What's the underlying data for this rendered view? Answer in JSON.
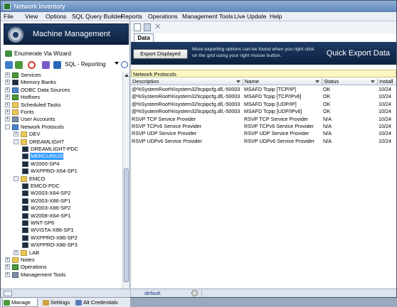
{
  "window": {
    "title": "Network Inventory"
  },
  "menu": [
    "File",
    "View",
    "Options",
    "SQL Query Builder",
    "Reports",
    "Operations",
    "Management Tools",
    "Live Update",
    "Help"
  ],
  "left_panel": {
    "banner_title": "Machine Management",
    "enumerate_label": "Enumerate Via Wizard",
    "sql_dropdown": "SQL - Reporting",
    "tree": [
      {
        "label": "Services",
        "ex": "+",
        "icon": "green",
        "depth": 0
      },
      {
        "label": "Memory Banks",
        "ex": "+",
        "icon": "pc",
        "depth": 0
      },
      {
        "label": "ODBC Data Sources",
        "ex": "+",
        "icon": "net",
        "depth": 0
      },
      {
        "label": "Hotfixes",
        "ex": "+",
        "icon": "green",
        "depth": 0
      },
      {
        "label": "Scheduled Tasks",
        "ex": "+",
        "icon": "fold",
        "depth": 0
      },
      {
        "label": "Fonts",
        "ex": "+",
        "icon": "fold",
        "depth": 0
      },
      {
        "label": "User Accounts",
        "ex": "+",
        "icon": "grp",
        "depth": 0
      },
      {
        "label": "Network Protocols",
        "ex": "-",
        "icon": "net",
        "depth": 0
      },
      {
        "label": "DEV",
        "ex": "+",
        "icon": "fold",
        "depth": 1
      },
      {
        "label": "DREAMLIGHT",
        "ex": "-",
        "icon": "fold",
        "depth": 1
      },
      {
        "label": "DREAMLIGHT-PDC",
        "ex": "",
        "icon": "pc",
        "depth": 2
      },
      {
        "label": "MERCURIUS",
        "ex": "",
        "icon": "pc",
        "depth": 2,
        "selected": true
      },
      {
        "label": "W2000-SP4",
        "ex": "",
        "icon": "pc",
        "depth": 2
      },
      {
        "label": "WXPPRO-X64-SP1",
        "ex": "",
        "icon": "pc",
        "depth": 2
      },
      {
        "label": "EMCO",
        "ex": "-",
        "icon": "fold",
        "depth": 1
      },
      {
        "label": "EMCO-PDC",
        "ex": "",
        "icon": "pc",
        "depth": 2
      },
      {
        "label": "W2003-X64-SP2",
        "ex": "",
        "icon": "pc",
        "depth": 2
      },
      {
        "label": "W2003-X86-SP1",
        "ex": "",
        "icon": "pc",
        "depth": 2
      },
      {
        "label": "W2003-X86-SP2",
        "ex": "",
        "icon": "pc",
        "depth": 2
      },
      {
        "label": "W2008-X64-SP1",
        "ex": "",
        "icon": "pc",
        "depth": 2
      },
      {
        "label": "WNT-SP6",
        "ex": "",
        "icon": "pc",
        "depth": 2
      },
      {
        "label": "WVISTA-X86-SP1",
        "ex": "",
        "icon": "pc",
        "depth": 2
      },
      {
        "label": "WXPPRO-X86-SP2",
        "ex": "",
        "icon": "pc",
        "depth": 2
      },
      {
        "label": "WXPPRO-X86-SP3",
        "ex": "",
        "icon": "pc",
        "depth": 2
      },
      {
        "label": "LAB",
        "ex": "+",
        "icon": "fold",
        "depth": 1
      },
      {
        "label": "Notes",
        "ex": "+",
        "icon": "fold",
        "depth": 0
      },
      {
        "label": "Operations",
        "ex": "+",
        "icon": "green",
        "depth": 0
      },
      {
        "label": "Management Tools",
        "ex": "+",
        "icon": "grp",
        "depth": 0
      }
    ],
    "bottom_tabs": [
      "Manage",
      "Settings",
      "Alt Credentials"
    ]
  },
  "right_panel": {
    "tab_label": "Data",
    "export_button": "Export Displayed",
    "export_note": "More exporting options can be found when you right click on the grid using your right mouse button.",
    "export_title": "Quick Export Data",
    "group_header": "Network Protocols",
    "columns": [
      "Description",
      "Name",
      "Status",
      "Install"
    ],
    "rows": [
      [
        "@%SystemRoot%\\system32\\tcpipcfg.dll,-50003",
        "MSAFD Tcpip [TCP/IP]",
        "OK",
        "10/24"
      ],
      [
        "@%SystemRoot%\\system32\\tcpipcfg.dll,-50003",
        "MSAFD Tcpip [TCP/IPv6]",
        "OK",
        "10/24"
      ],
      [
        "@%SystemRoot%\\system32\\tcpipcfg.dll,-50003",
        "MSAFD Tcpip [UDP/IP]",
        "OK",
        "10/24"
      ],
      [
        "@%SystemRoot%\\system32\\tcpipcfg.dll,-50003",
        "MSAFD Tcpip [UDP/IPv6]",
        "OK",
        "10/24"
      ],
      [
        "RSVP TCP Service Provider",
        "RSVP TCP Service Provider",
        "N/A",
        "10/24"
      ],
      [
        "RSVP TCPv6 Service Provider",
        "RSVP TCPv6 Service Provider",
        "N/A",
        "10/24"
      ],
      [
        "RSVP UDP Service Provider",
        "RSVP UDP Service Provider",
        "N/A",
        "10/24"
      ],
      [
        "RSVP UDPv6 Service Provider",
        "RSVP UDPv6 Service Provider",
        "N/A",
        "10/24"
      ]
    ]
  },
  "status_bar": {
    "profile": "default"
  }
}
